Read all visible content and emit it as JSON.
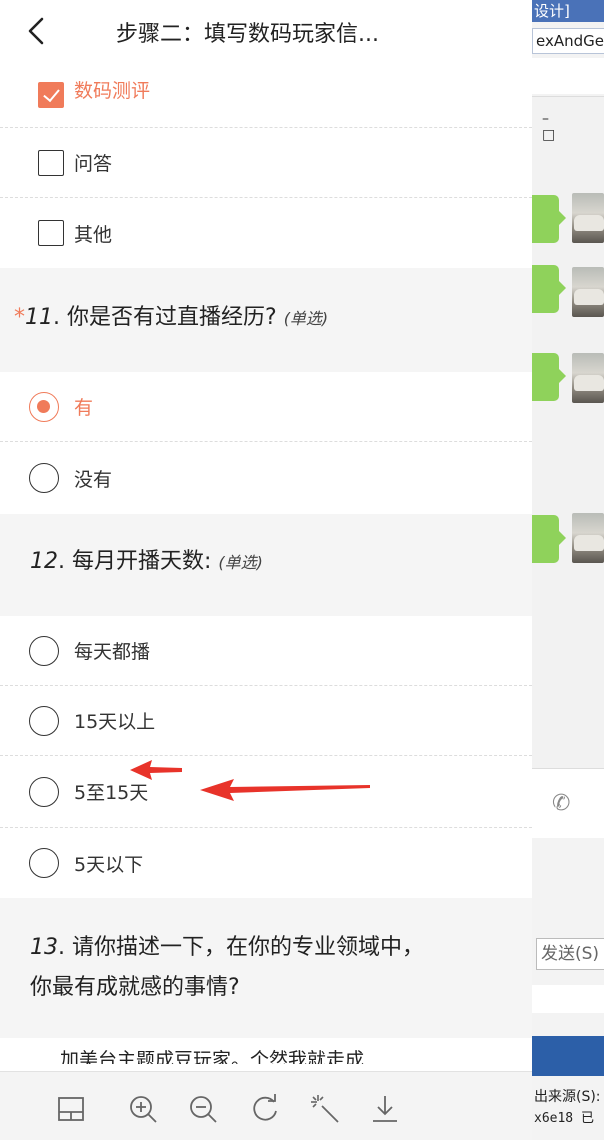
{
  "header": {
    "title": "步骤二：填写数码玩家信..."
  },
  "checkbox_options": [
    {
      "label": "数码测评",
      "checked": true
    },
    {
      "label": "问答",
      "checked": false
    },
    {
      "label": "其他",
      "checked": false
    }
  ],
  "q11": {
    "required": "*",
    "number": "11",
    "sep": ".",
    "text": "你是否有过直播经历?",
    "tag": "(单选)",
    "options": [
      {
        "label": "有",
        "selected": true
      },
      {
        "label": "没有",
        "selected": false
      }
    ]
  },
  "q12": {
    "number": "12",
    "sep": ".",
    "text": "每月开播天数:",
    "tag": "(单选)",
    "options": [
      {
        "label": "每天都播"
      },
      {
        "label": "15天以上"
      },
      {
        "label": "5至15天"
      },
      {
        "label": "5天以下"
      }
    ]
  },
  "q13": {
    "number": "13",
    "sep": ".",
    "line1": "请你描述一下，在你的专业领域中，",
    "line2": "你最有成就感的事情?"
  },
  "answer_preview": "加美台主题成豆玩家。个然我就走成",
  "toolbar": {
    "icons": [
      "layout-icon",
      "zoom-in-icon",
      "zoom-out-icon",
      "rotate-icon",
      "magic-wand-icon",
      "download-icon"
    ]
  },
  "background_window": {
    "title": "设计]",
    "tab": "exAndGe",
    "window_controls": "– □",
    "send_button": "发送(S)",
    "status_line1": "出来源(S):",
    "status_line2": "x6e18 已"
  },
  "colors": {
    "accent": "#f07b5a",
    "bubble": "#8fd25b",
    "arrow": "#e8332a"
  }
}
